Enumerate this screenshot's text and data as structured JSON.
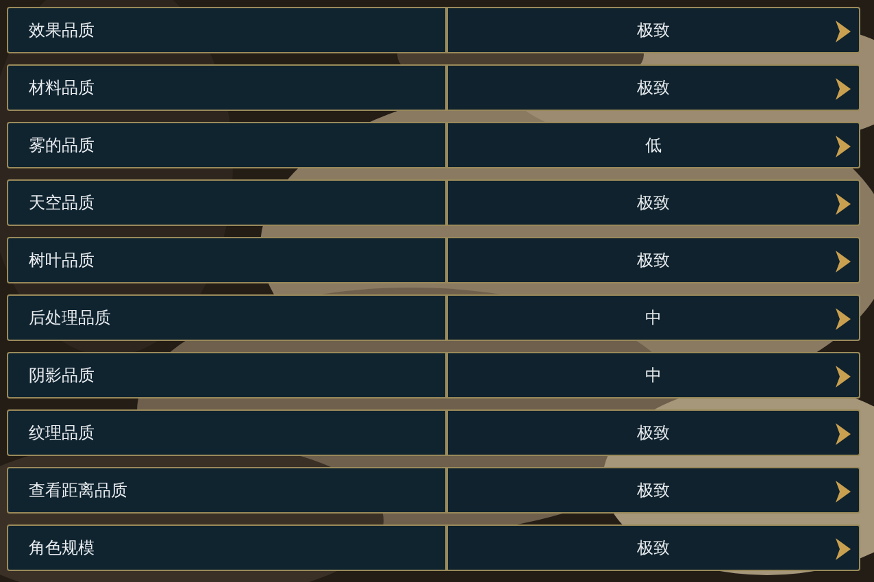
{
  "settings": [
    {
      "label": "效果品质",
      "value": "极致"
    },
    {
      "label": "材料品质",
      "value": "极致"
    },
    {
      "label": "雾的品质",
      "value": "低"
    },
    {
      "label": "天空品质",
      "value": "极致"
    },
    {
      "label": "树叶品质",
      "value": "极致"
    },
    {
      "label": "后处理品质",
      "value": "中"
    },
    {
      "label": "阴影品质",
      "value": "中"
    },
    {
      "label": "纹理品质",
      "value": "极致"
    },
    {
      "label": "查看距离品质",
      "value": "极致"
    },
    {
      "label": "角色规模",
      "value": "极致"
    }
  ]
}
